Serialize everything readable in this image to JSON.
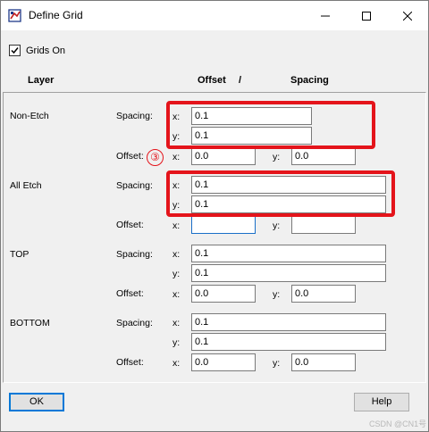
{
  "window": {
    "title": "Define Grid"
  },
  "grids_on": {
    "label": "Grids On",
    "checked": true
  },
  "headers": {
    "layer": "Layer",
    "offset": "Offset",
    "slash": "/",
    "spacing": "Spacing"
  },
  "field_labels": {
    "spacing": "Spacing:",
    "offset": "Offset:",
    "x": "x:",
    "y": "y:"
  },
  "layers": [
    {
      "name": "Non-Etch",
      "spacing_x": "0.1",
      "spacing_y": "0.1",
      "offset_x": "0.0",
      "offset_y": "0.0"
    },
    {
      "name": "All Etch",
      "spacing_x": "0.1",
      "spacing_y": "0.1",
      "offset_x": "",
      "offset_y": ""
    },
    {
      "name": "TOP",
      "spacing_x": "0.1",
      "spacing_y": "0.1",
      "offset_x": "0.0",
      "offset_y": "0.0"
    },
    {
      "name": "BOTTOM",
      "spacing_x": "0.1",
      "spacing_y": "0.1",
      "offset_x": "0.0",
      "offset_y": "0.0"
    }
  ],
  "annotation": {
    "marker": "③",
    "color": "#e4141b"
  },
  "buttons": {
    "ok": "OK",
    "help": "Help"
  },
  "watermark": "CSDN @CN1号"
}
